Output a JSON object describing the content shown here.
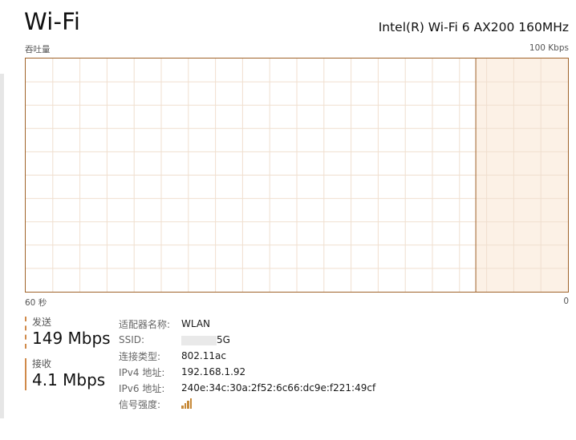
{
  "header": {
    "title": "Wi-Fi",
    "adapter": "Intel(R) Wi-Fi 6 AX200 160MHz"
  },
  "graph": {
    "y_label": "吞吐量",
    "y_max_label": "100 Kbps",
    "x_label": "60 秒",
    "x_min_label": "0",
    "line_color": "#a0632a",
    "grid_color": "#f0dfcf",
    "history_fill": "#fcf1e6",
    "history_fraction": 0.17
  },
  "send": {
    "label": "发送",
    "value": "149 Mbps"
  },
  "receive": {
    "label": "接收",
    "value": "4.1 Mbps"
  },
  "details": {
    "adapter_name_label": "适配器名称:",
    "adapter_name_value": "WLAN",
    "ssid_label": "SSID:",
    "ssid_value": "5G",
    "connection_type_label": "连接类型:",
    "connection_type_value": "802.11ac",
    "ipv4_label": "IPv4 地址:",
    "ipv4_value": "192.168.1.92",
    "ipv6_label": "IPv6 地址:",
    "ipv6_value": "240e:34c:30a:2f52:6c66:dc9e:f221:49cf",
    "signal_label": "信号强度:",
    "signal_icon": "signal-strength-icon",
    "signal_bars": 4
  }
}
